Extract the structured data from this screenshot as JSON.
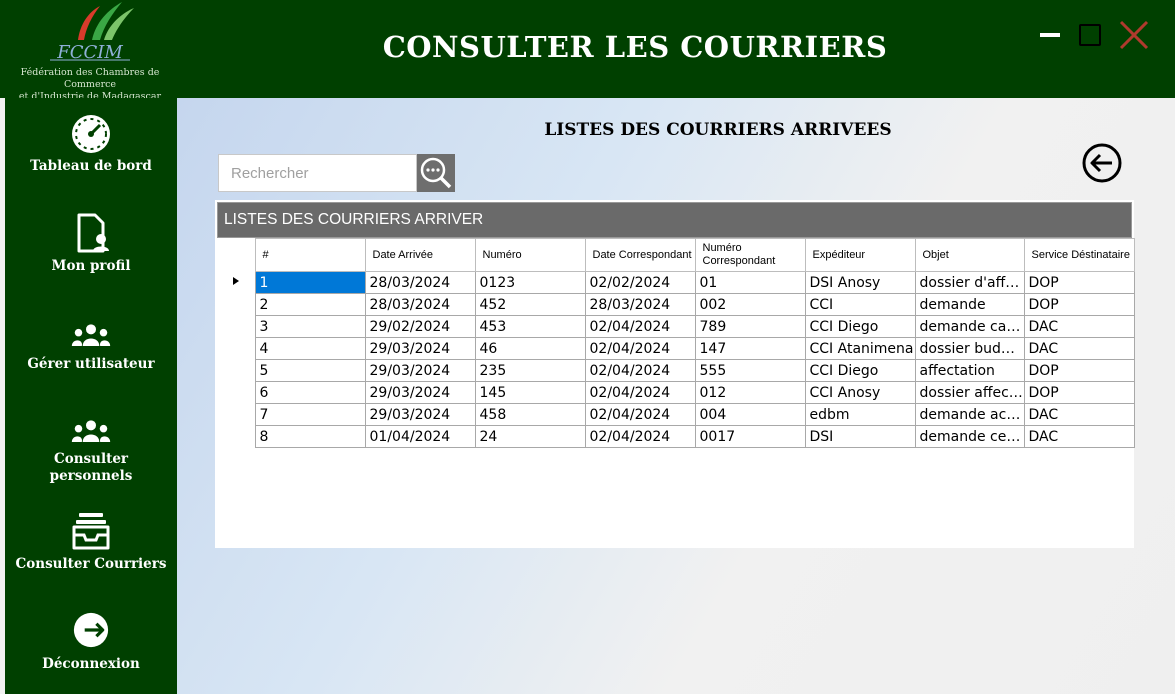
{
  "window": {
    "title": "CONSULTER LES COURRIERS",
    "logo_caption_line1": "Fédération des Chambres de Commerce",
    "logo_caption_line2": "et d'Industrie de Madagascar",
    "logo_text": "FCCIM"
  },
  "colors": {
    "header": "#004000",
    "selection": "#0078d7",
    "grid_caption": "#6a6a6a",
    "close": "#c0392b"
  },
  "sidebar": {
    "items": [
      {
        "label": "Tableau de bord",
        "icon": "dashboard-gauge-icon"
      },
      {
        "label": "Mon profil",
        "icon": "profile-file-icon"
      },
      {
        "label": "Gérer  utilisateur",
        "icon": "users-group-icon"
      },
      {
        "label": "Consulter personnels",
        "icon": "staff-group-icon"
      },
      {
        "label": "Consulter Courriers",
        "icon": "inbox-tray-icon"
      },
      {
        "label": "Déconnexion",
        "icon": "logout-arrow-icon"
      }
    ]
  },
  "main": {
    "heading": "LISTES DES COURRIERS ARRIVEES",
    "search": {
      "placeholder": "Rechercher",
      "value": ""
    },
    "grid": {
      "caption": "LISTES DES COURRIERS ARRIVER",
      "columns": [
        "#",
        "Date Arrivée",
        "Numéro",
        "Date Correspondant",
        "Numéro Correspondant",
        "Expéditeur",
        "Objet",
        "Service Déstinataire"
      ],
      "rows": [
        [
          "1",
          "28/03/2024",
          "0123",
          "02/02/2024",
          "01",
          "DSI Anosy",
          "dossier d'affectation",
          "DOP"
        ],
        [
          "2",
          "28/03/2024",
          "452",
          "28/03/2024",
          "002",
          "CCI",
          "demande",
          "DOP"
        ],
        [
          "3",
          "29/02/2024",
          "453",
          "02/04/2024",
          "789",
          "CCI Diego",
          "demande cachet",
          "DAC"
        ],
        [
          "4",
          "29/03/2024",
          "46",
          "02/04/2024",
          "147",
          "CCI Atanimena",
          "dossier budgétaire",
          "DAC"
        ],
        [
          "5",
          "29/03/2024",
          "235",
          "02/04/2024",
          "555",
          "CCI Diego",
          "affectation",
          "DOP"
        ],
        [
          "6",
          "29/03/2024",
          "145",
          "02/04/2024",
          "012",
          "CCI Anosy",
          "dossier affectation",
          "DOP"
        ],
        [
          "7",
          "29/03/2024",
          "458",
          "02/04/2024",
          "004",
          "edbm",
          "demande  accord",
          "DAC"
        ],
        [
          "8",
          "01/04/2024",
          "24",
          "02/04/2024",
          "0017",
          "DSI",
          "demande certificat",
          "DAC"
        ]
      ],
      "selected_row": 0
    }
  }
}
